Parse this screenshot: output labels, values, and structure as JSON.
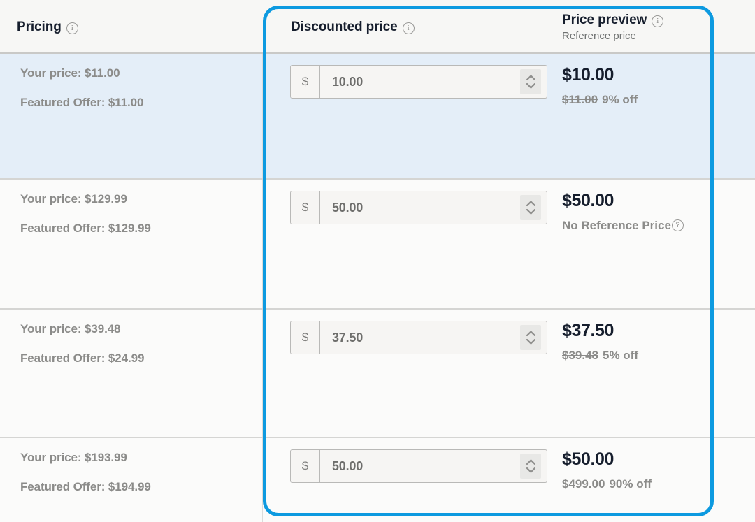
{
  "columns": {
    "pricing": {
      "title": "Pricing",
      "info_icon": "info-icon"
    },
    "discounted": {
      "title": "Discounted price",
      "info_icon": "info-icon"
    },
    "preview": {
      "title": "Price preview",
      "subtitle": "Reference price",
      "info_icon": "info-icon"
    }
  },
  "currency_symbol": "$",
  "accent_color": "#0d9ae0",
  "selected_row_color": "#e4eef8",
  "rows": [
    {
      "selected": true,
      "your_price_label": "Your price: $11.00",
      "featured_offer_label": "Featured Offer: $11.00",
      "discounted_input_value": "10.00",
      "preview_price": "$10.00",
      "reference_price": "$11.00",
      "discount_text": "9% off",
      "no_reference": false
    },
    {
      "selected": false,
      "your_price_label": "Your price: $129.99",
      "featured_offer_label": "Featured Offer: $129.99",
      "discounted_input_value": "50.00",
      "preview_price": "$50.00",
      "reference_price": "",
      "discount_text": "",
      "no_reference": true,
      "no_reference_text": "No Reference Price",
      "help_icon": "question-mark-icon"
    },
    {
      "selected": false,
      "your_price_label": "Your price: $39.48",
      "featured_offer_label": "Featured Offer: $24.99",
      "discounted_input_value": "37.50",
      "preview_price": "$37.50",
      "reference_price": "$39.48",
      "discount_text": "5% off",
      "no_reference": false
    },
    {
      "selected": false,
      "your_price_label": "Your price: $193.99",
      "featured_offer_label": "Featured Offer: $194.99",
      "discounted_input_value": "50.00",
      "preview_price": "$50.00",
      "reference_price": "$499.00",
      "discount_text": "90% off",
      "no_reference": false
    }
  ]
}
